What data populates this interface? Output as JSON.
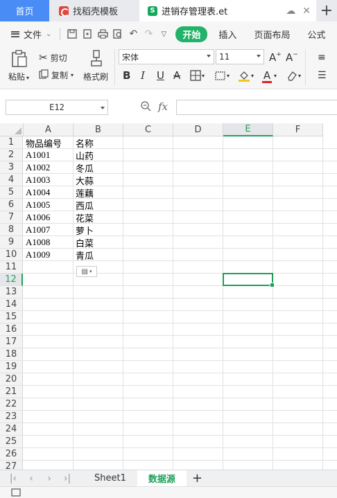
{
  "tabs": {
    "home": "首页",
    "template": "找稻壳模板",
    "document": "进销存管理表.et",
    "add": "+"
  },
  "menu": {
    "file": "文件",
    "start": "开始",
    "insert": "插入",
    "layout": "页面布局",
    "formula": "公式"
  },
  "ribbon": {
    "paste": "粘贴",
    "cut": "剪切",
    "copy": "复制",
    "format_painter": "格式刷",
    "font_name": "宋体",
    "font_size": "11"
  },
  "formula_bar": {
    "cell_ref": "E12",
    "fx": "fx"
  },
  "columns": [
    "A",
    "B",
    "C",
    "D",
    "E",
    "F"
  ],
  "selected_column": "E",
  "selected_row": 12,
  "rows": [
    1,
    2,
    3,
    4,
    5,
    6,
    7,
    8,
    9,
    10,
    11,
    12,
    13,
    14,
    15,
    16,
    17,
    18,
    19,
    20,
    21,
    22,
    23,
    24,
    25,
    26,
    27
  ],
  "cells": [
    [
      "物品编号",
      "名称"
    ],
    [
      "A1001",
      "山药"
    ],
    [
      "A1002",
      "冬瓜"
    ],
    [
      "A1003",
      "大蒜"
    ],
    [
      "A1004",
      "莲藕"
    ],
    [
      "A1005",
      "西瓜"
    ],
    [
      "A1006",
      "花菜"
    ],
    [
      "A1007",
      "萝卜"
    ],
    [
      "A1008",
      "白菜"
    ],
    [
      "A1009",
      "青瓜"
    ]
  ],
  "sheets": {
    "sheet1": "Sheet1",
    "sheet2": "数据源",
    "add": "+"
  },
  "colors": {
    "accent": "#22b26a",
    "home_tab": "#4a8cf6",
    "selection": "#1a9e55"
  }
}
